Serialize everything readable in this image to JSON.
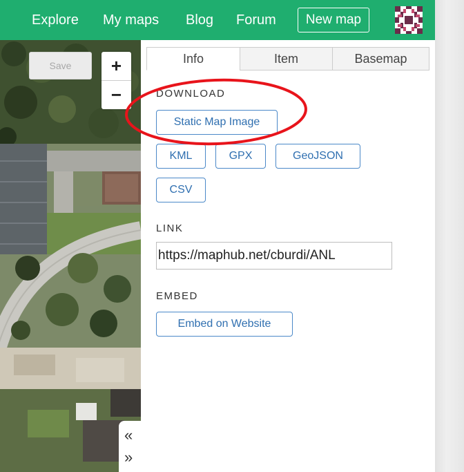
{
  "nav": {
    "links": [
      "Explore",
      "My maps",
      "Blog",
      "Forum"
    ],
    "new_map": "New map",
    "avatar_icon": "user-avatar-pattern",
    "bg_color": "#1fae6f"
  },
  "map": {
    "save_label": "Save",
    "zoom_in": "+",
    "zoom_out": "−",
    "collapse_icon": "«",
    "expand_icon": "»"
  },
  "panel": {
    "tabs": [
      "Info",
      "Item",
      "Basemap"
    ],
    "active_tab": "Info",
    "download": {
      "label": "DOWNLOAD",
      "buttons": [
        "Static Map Image",
        "KML",
        "GPX",
        "GeoJSON",
        "CSV"
      ]
    },
    "link": {
      "label": "LINK",
      "value": "https://maphub.net/cburdi/ANL"
    },
    "embed": {
      "label": "EMBED",
      "button": "Embed on Website"
    }
  },
  "annotation": {
    "color": "#e8141b",
    "target": "Static Map Image"
  }
}
